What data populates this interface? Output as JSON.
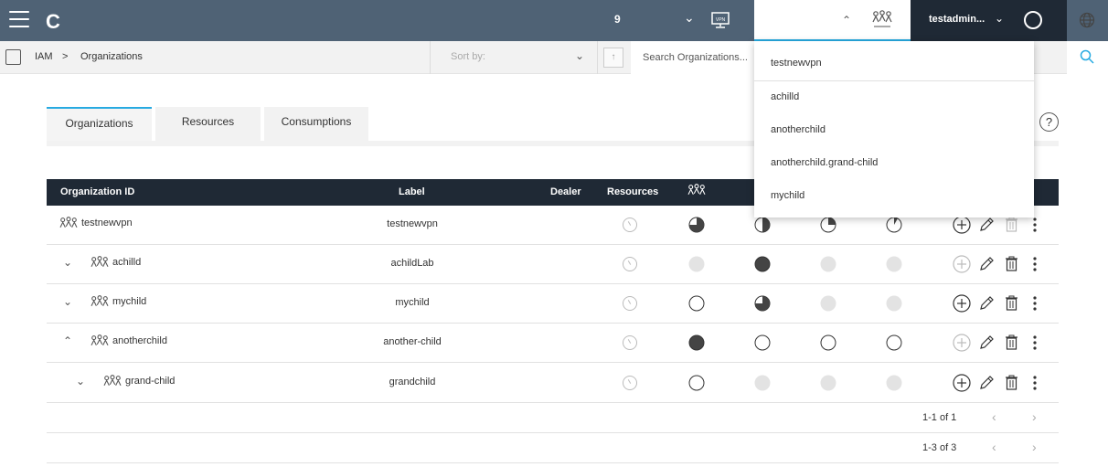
{
  "topbar": {
    "logo": "C",
    "count": "9",
    "username": "testadmin...",
    "colors": {
      "bar": "#4f6275",
      "dark": "#1f2935",
      "accent": "#27aae1"
    }
  },
  "breadcrumb": {
    "root": "IAM",
    "separator": ">",
    "current": "Organizations"
  },
  "toolbar": {
    "sort_placeholder": "Sort by:",
    "search_placeholder": "Search Organizations..."
  },
  "tabs": [
    {
      "label": "Organizations",
      "active": true
    },
    {
      "label": "Resources",
      "active": false
    },
    {
      "label": "Consumptions",
      "active": false
    }
  ],
  "help": "?",
  "table": {
    "headers": {
      "id": "Organization ID",
      "label": "Label",
      "dealer": "Dealer",
      "resources": "Resources"
    },
    "rows": [
      {
        "id": "testnewvpn",
        "label": "testnewvpn",
        "expand": "",
        "slots": [
          "q3",
          "half",
          "q1",
          "e"
        ],
        "add_enabled": true,
        "delete_enabled": false
      },
      {
        "id": "achilld",
        "label": "achildLab",
        "expand": "v",
        "slots": [
          "grey",
          "full",
          "grey",
          "grey"
        ],
        "add_enabled": false,
        "delete_enabled": true
      },
      {
        "id": "mychild",
        "label": "mychild",
        "expand": "v",
        "slots": [
          "empty",
          "q3",
          "grey",
          "grey"
        ],
        "add_enabled": true,
        "delete_enabled": true
      },
      {
        "id": "anotherchild",
        "label": "another-child",
        "expand": "^",
        "slots": [
          "full",
          "empty",
          "empty",
          "empty"
        ],
        "add_enabled": false,
        "delete_enabled": true
      },
      {
        "id": "grand-child",
        "label": "grandchild",
        "expand": "v",
        "slots": [
          "empty",
          "grey",
          "grey",
          "grey"
        ],
        "add_enabled": true,
        "delete_enabled": true
      }
    ]
  },
  "pagers": [
    {
      "range": "1-1 of 1"
    },
    {
      "range": "1-3 of 3"
    }
  ],
  "dropdown": {
    "items": [
      "testnewvpn",
      "achilld",
      "anotherchild",
      "anotherchild.grand-child",
      "mychild"
    ]
  }
}
